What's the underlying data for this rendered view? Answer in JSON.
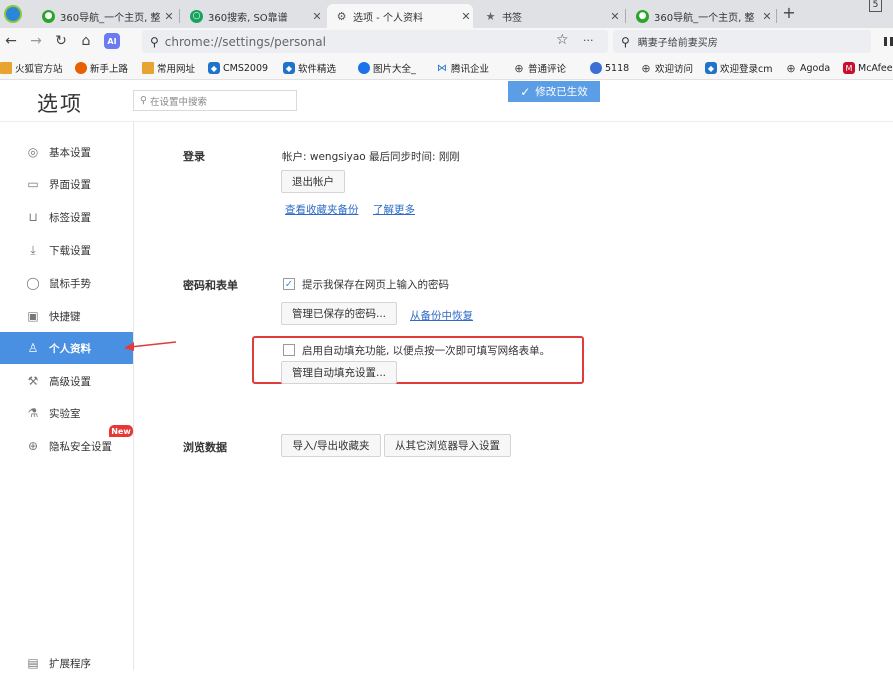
{
  "tabs": [
    {
      "title": "360导航_一个主页, 整",
      "active": false
    },
    {
      "title": "360搜索, SO靠谱",
      "active": false
    },
    {
      "title": "选项 - 个人资料",
      "active": true
    },
    {
      "title": "书签",
      "active": false
    },
    {
      "title": "360导航_一个主页, 整",
      "active": false
    }
  ],
  "new_tab_symbol": "+",
  "window_badge": "5",
  "toolbar": {
    "address": "chrome://settings/personal",
    "star_icon": "star-icon",
    "more_symbol": "···",
    "search_text": "瞒妻子给前妻买房"
  },
  "bookmarks": [
    {
      "label": "火狐官方站",
      "color": "#e8a431"
    },
    {
      "label": "新手上路",
      "color": "#e66000"
    },
    {
      "label": "常用网址",
      "color": "#e8a431"
    },
    {
      "label": "CMS2009",
      "color": "#1f74c9"
    },
    {
      "label": "软件精选",
      "color": "#1f74c9"
    },
    {
      "label": "图片大全_",
      "color": "#1a73e8"
    },
    {
      "label": "腾讯企业",
      "color": "#1f74c9"
    },
    {
      "label": "普通评论",
      "color": "#666666"
    },
    {
      "label": "5118",
      "color": "#3b6fd6"
    },
    {
      "label": "欢迎访问",
      "color": "#666666"
    },
    {
      "label": "欢迎登录cm",
      "color": "#1f74c9"
    },
    {
      "label": "Agoda",
      "color": "#666666"
    },
    {
      "label": "McAfee",
      "color": "#c8102e"
    }
  ],
  "page": {
    "title": "选项",
    "search_placeholder": "在设置中搜索",
    "toast": "修改已生效"
  },
  "sidebar": {
    "items": [
      {
        "label": "基本设置",
        "icon": "gear-circle-icon"
      },
      {
        "label": "界面设置",
        "icon": "window-icon"
      },
      {
        "label": "标签设置",
        "icon": "tab-icon"
      },
      {
        "label": "下载设置",
        "icon": "download-icon"
      },
      {
        "label": "鼠标手势",
        "icon": "mouse-icon"
      },
      {
        "label": "快捷键",
        "icon": "keyboard-icon"
      },
      {
        "label": "个人资料",
        "icon": "person-icon",
        "active": true
      },
      {
        "label": "高级设置",
        "icon": "wrench-icon"
      },
      {
        "label": "实验室",
        "icon": "flask-icon"
      },
      {
        "label": "隐私安全设置",
        "icon": "shield-icon"
      }
    ],
    "new_badge": "New",
    "extensions_label": "扩展程序"
  },
  "login": {
    "title": "登录",
    "account_info": "帐户: wengsiyao 最后同步时间: 刚刚",
    "logout_button": "退出帐户",
    "link_backup": "查看收藏夹备份",
    "link_more": "了解更多"
  },
  "passwords": {
    "title": "密码和表单",
    "save_password_label": "提示我保存在网页上输入的密码",
    "save_password_checked": true,
    "manage_passwords_button": "管理已保存的密码...",
    "restore_link": "从备份中恢复",
    "autofill_label": "启用自动填充功能, 以便点按一次即可填写网络表单。",
    "autofill_checked": false,
    "autofill_button": "管理自动填充设置..."
  },
  "browsing": {
    "title": "浏览数据",
    "import_export_button": "导入/导出收藏夹",
    "import_other_button": "从其它浏览器导入设置"
  },
  "colors": {
    "accent": "#4a90e2",
    "annotation_red": "#e23b3b",
    "link": "#2e6bc6"
  }
}
